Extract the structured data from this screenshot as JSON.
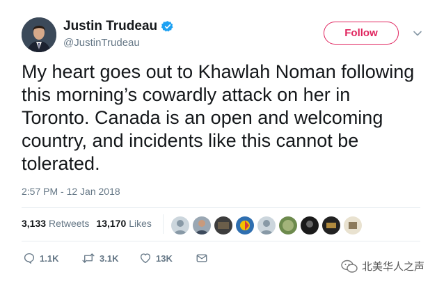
{
  "author": {
    "name": "Justin Trudeau",
    "handle": "@JustinTrudeau",
    "verified": true
  },
  "follow_label": "Follow",
  "tweet": {
    "text": "My heart goes out to Khawlah Noman following this morning’s cowardly attack on her in Toronto. Canada is an open and welcoming country, and incidents like this cannot be tolerated.",
    "timestamp": "2:57 PM - 12 Jan 2018"
  },
  "stats": {
    "retweets_count": "3,133",
    "retweets_label": "Retweets",
    "likes_count": "13,170",
    "likes_label": "Likes"
  },
  "actions": {
    "reply_count": "1.1K",
    "retweet_count": "3.1K",
    "like_count": "13K"
  },
  "watermark": "北美华人之声",
  "colors": {
    "follow_accent": "#e0245e",
    "verified_blue": "#1da1f2",
    "secondary_text": "#657786"
  }
}
